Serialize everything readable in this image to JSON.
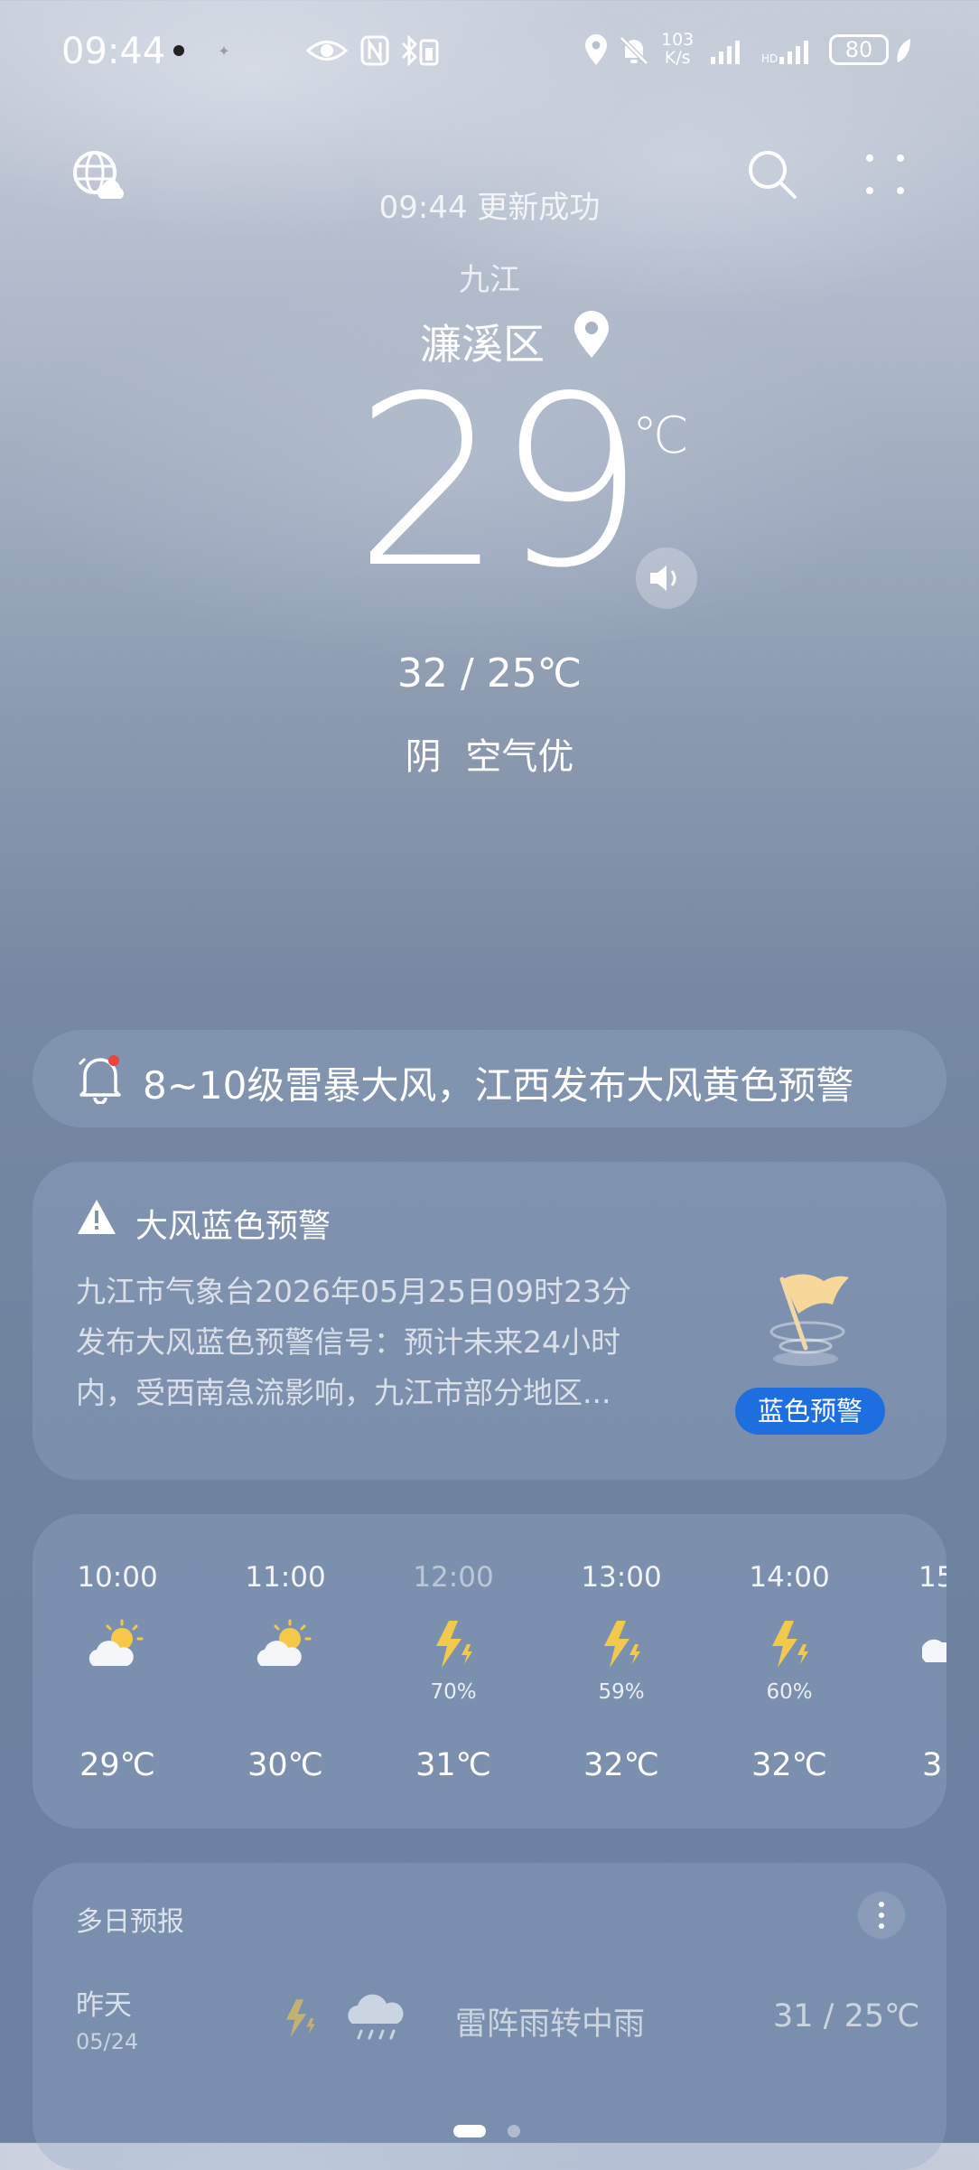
{
  "status_bar": {
    "time": "09:44",
    "net_speed_value": "103",
    "net_speed_unit": "K/s",
    "battery": "80"
  },
  "header": {
    "update_status": "09:44 更新成功",
    "city": "九江",
    "district": "濂溪区"
  },
  "current": {
    "temperature": "29",
    "unit": "℃",
    "range": "32 / 25℃",
    "condition": "阴 空气优"
  },
  "alert_banner": {
    "text": "8~10级雷暴大风，江西发布大风黄色预警"
  },
  "warning_card": {
    "title": "大风蓝色预警",
    "body_lines": [
      "九江市气象台2026年05月25日09时23分",
      "发布大风蓝色预警信号：预计未来24小时",
      "内，受西南急流影响，九江市部分地区..."
    ],
    "badge": "蓝色预警",
    "badge_color": "#1d6fe0"
  },
  "hourly": [
    {
      "time": "10:00",
      "icon": "partly-cloudy-icon",
      "precip": "",
      "temp": "29℃"
    },
    {
      "time": "11:00",
      "icon": "partly-cloudy-icon",
      "precip": "",
      "temp": "30℃"
    },
    {
      "time": "12:00",
      "icon": "thunder-icon",
      "precip": "70%",
      "temp": "31℃"
    },
    {
      "time": "13:00",
      "icon": "thunder-icon",
      "precip": "59%",
      "temp": "32℃"
    },
    {
      "time": "14:00",
      "icon": "thunder-icon",
      "precip": "60%",
      "temp": "32℃"
    },
    {
      "time": "15",
      "icon": "partly-cloudy-icon",
      "precip": "",
      "temp": "3"
    }
  ],
  "multi_day": {
    "title": "多日预报",
    "rows": [
      {
        "day": "昨天",
        "date": "05/24",
        "description": "雷阵雨转中雨",
        "range": "31 / 25℃"
      }
    ]
  },
  "colors": {
    "sun": "#f5c84a",
    "lightning": "#f2c94c"
  }
}
